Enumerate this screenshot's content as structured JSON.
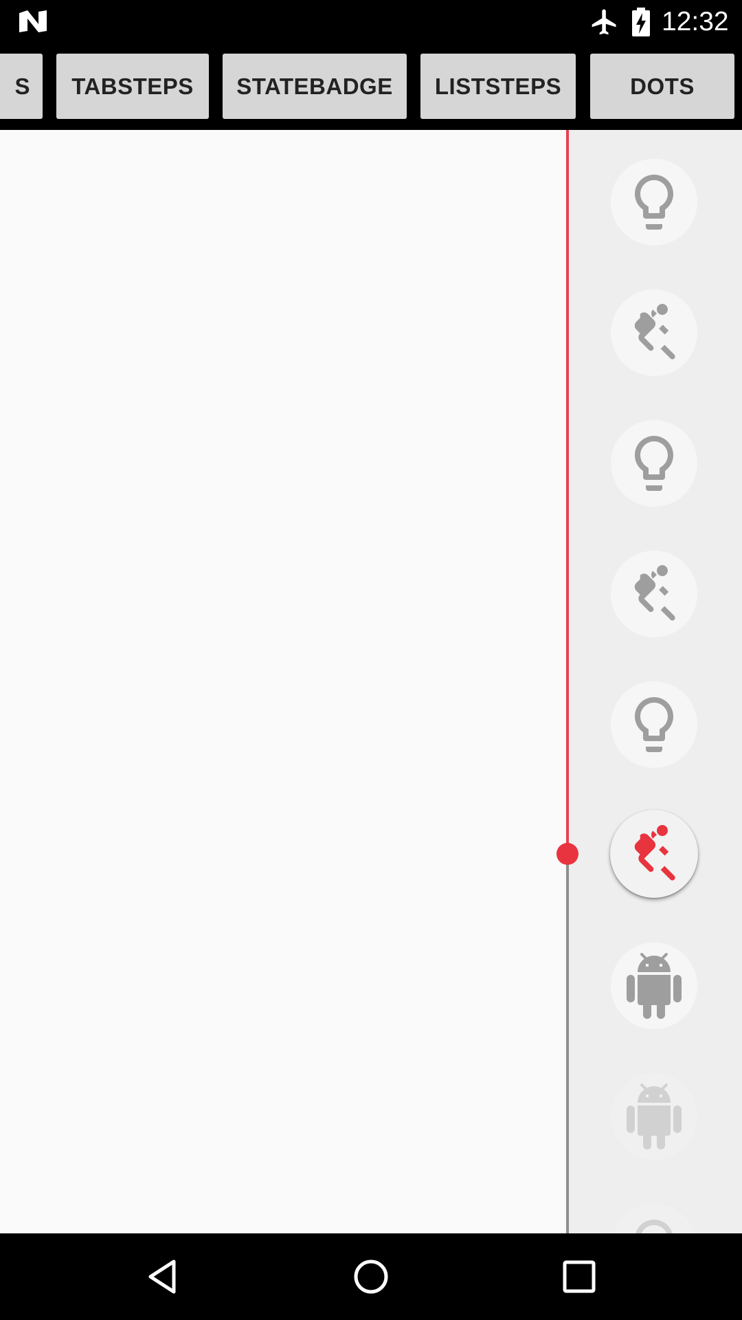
{
  "status_bar": {
    "time": "12:32",
    "icons": [
      "android-n-icon",
      "airplane-mode-icon",
      "battery-charging-icon"
    ]
  },
  "tabs": [
    {
      "label": "S"
    },
    {
      "label": "TABSTEPS"
    },
    {
      "label": "STATEBADGE"
    },
    {
      "label": "LISTSTEPS"
    },
    {
      "label": "DOTS"
    }
  ],
  "steps": [
    {
      "icon": "lightbulb-icon",
      "state": "inactive"
    },
    {
      "icon": "seat-belt-icon",
      "state": "inactive"
    },
    {
      "icon": "lightbulb-icon",
      "state": "inactive"
    },
    {
      "icon": "seat-belt-icon",
      "state": "inactive"
    },
    {
      "icon": "lightbulb-icon",
      "state": "inactive"
    },
    {
      "icon": "seat-belt-icon",
      "state": "active"
    },
    {
      "icon": "android-icon",
      "state": "inactive"
    },
    {
      "icon": "android-icon",
      "state": "faded"
    },
    {
      "icon": "lightbulb-icon",
      "state": "faded"
    }
  ],
  "colors": {
    "accent": "#e8404e",
    "inactive_icon": "#9e9e9e",
    "timeline_inactive": "#8e8e8e"
  },
  "nav_bar": {
    "icons": [
      "back-icon",
      "home-icon",
      "recents-icon"
    ]
  }
}
